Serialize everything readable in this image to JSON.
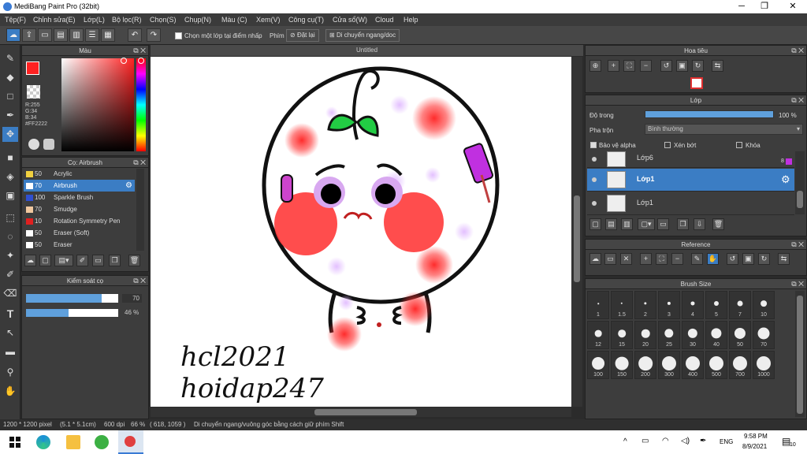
{
  "app": {
    "title": "MediBang Paint Pro (32bit)",
    "min": "─",
    "max": "❐",
    "close": "✕"
  },
  "menu": [
    "Tệp(F)",
    "Chỉnh sửa(E)",
    "Lớp(L)",
    "Bộ lọc(R)",
    "Chọn(S)",
    "Chụp(N)",
    "Màu (C)",
    "Xem(V)",
    "Công cụ(T)",
    "Cửa sổ(W)",
    "Cloud",
    "Help"
  ],
  "toolbar": {
    "checkbox_label": "Chọn một lớp tại điểm nhấp",
    "phim_label": "Phím",
    "reset_label": "Đặt lại",
    "move_label": "Di chuyển ngang/doc"
  },
  "color_panel": {
    "title": "Màu",
    "r": "R:255",
    "g": "G:34",
    "b": "B:34",
    "hex": "#FF2222",
    "primary": "#ff2222"
  },
  "brush_panel": {
    "title": "Cọ: Airbrush",
    "items": [
      {
        "size": "50",
        "name": "Acrylic",
        "color": "#f0d040"
      },
      {
        "size": "70",
        "name": "Airbrush",
        "color": "#ffffff"
      },
      {
        "size": "100",
        "name": "Sparkle Brush",
        "color": "#3050d0"
      },
      {
        "size": "70",
        "name": "Smudge",
        "color": "#f0c8a0"
      },
      {
        "size": "10",
        "name": "Rotation Symmetry Pen",
        "color": "#e02020"
      },
      {
        "size": "50",
        "name": "Eraser (Soft)",
        "color": "#ffffff"
      },
      {
        "size": "50",
        "name": "Eraser",
        "color": "#ffffff"
      }
    ]
  },
  "brush_control": {
    "title": "Kiểm soát cọ",
    "size_value": "70",
    "opacity_value": "46 %",
    "size_fraction": 0.82,
    "opacity_fraction": 0.46
  },
  "document": {
    "tab": "Untitled",
    "text_line1": "hcl2021",
    "text_line2": "hoidap247"
  },
  "navigator": {
    "title": "Hoa tiêu"
  },
  "layer_panel": {
    "title": "Lớp",
    "opacity_label": "Độ trong",
    "opacity_value": "100 %",
    "blend_label": "Pha trộn",
    "blend_value": "Bình thường",
    "alpha_label": "Bảo vệ alpha",
    "clip_label": "Xén bớt",
    "lock_label": "Khóa",
    "layers": [
      {
        "name": "Lớp6",
        "badge": "8"
      },
      {
        "name": "Lớp1"
      },
      {
        "name": "Lớp1"
      }
    ]
  },
  "reference_panel": {
    "title": "Reference"
  },
  "brush_size_panel": {
    "title": "Brush Size",
    "rows": [
      [
        "1",
        "1.5",
        "2",
        "3",
        "4",
        "5",
        "7",
        "10"
      ],
      [
        "12",
        "15",
        "20",
        "25",
        "30",
        "40",
        "50",
        "70"
      ],
      [
        "100",
        "150",
        "200",
        "300",
        "400",
        "500",
        "700",
        "1000"
      ]
    ]
  },
  "status": {
    "dims": "1200 * 1200 pixel",
    "size": "(5.1 * 5.1cm)",
    "dpi": "600 dpi",
    "zoom": "66 %",
    "coords": "( 618, 1059 )",
    "hint": "Di chuyển ngang/vuông góc bằng cách giữ phím Shift"
  },
  "taskbar": {
    "time": "9:58 PM",
    "date": "8/9/2021",
    "lang": "ENG",
    "notif": "10"
  }
}
